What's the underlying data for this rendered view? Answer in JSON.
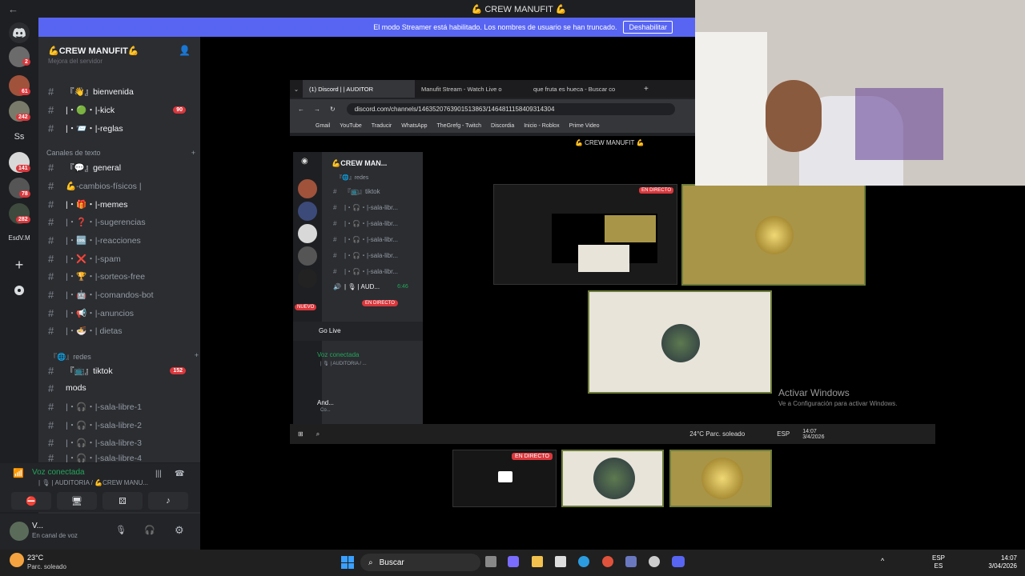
{
  "window": {
    "title": "💪 CREW MANUFIT 💪",
    "back_glyph": "←",
    "forward_glyph": "→"
  },
  "banner": {
    "message": "El modo Streamer está habilitado. Los nombres de usuario se han truncado.",
    "button": "Deshabilitar"
  },
  "rail": {
    "badges": [
      "2",
      "61",
      "242",
      "141",
      "78",
      "282"
    ],
    "initials": "Ss",
    "label": "EsdV.M"
  },
  "server": {
    "name": "💪CREW MANUFIT💪",
    "partial_top": "Mejora del servidor"
  },
  "channels_top": [
    {
      "label": "『👋』bienvenida",
      "count": ""
    },
    {
      "label": "|・🟢・|-kick",
      "count": "90"
    },
    {
      "label": "|・📨・|-reglas",
      "count": ""
    }
  ],
  "category_text": "Canales de texto",
  "channels_text": [
    {
      "label": "『💬』general",
      "white": true
    },
    {
      "label": "💪-cambios-físicos |",
      "white": false
    },
    {
      "label": "|・🎁・|-memes",
      "white": true
    },
    {
      "label": "|・❓・|-sugerencias",
      "white": false
    },
    {
      "label": "|・🆒・|-reacciones",
      "white": false
    },
    {
      "label": "|・❌・|-spam",
      "white": false
    },
    {
      "label": "|・🏆・|-sorteos-free",
      "white": false
    },
    {
      "label": "|・🤖・|-comandos-bot",
      "white": false
    },
    {
      "label": "|・📢・|-anuncios",
      "white": false
    },
    {
      "label": "|・🍜・| dietas",
      "white": false
    }
  ],
  "category_redes": "『🌐』redes",
  "channels_redes": [
    {
      "label": "『📺』tiktok",
      "count": "152",
      "white": true
    },
    {
      "label": "mods",
      "count": "",
      "white": true
    },
    {
      "label": "|・🎧・|-sala-libre-1",
      "count": "",
      "white": false
    },
    {
      "label": "|・🎧・|-sala-libre-2",
      "count": "",
      "white": false
    },
    {
      "label": "|・🎧・|-sala-libre-3",
      "count": "",
      "white": false
    },
    {
      "label": "|・🎧・|-sala-libre-4",
      "count": "",
      "white": false
    }
  ],
  "voice": {
    "status": "Voz conectada",
    "location": "| 🎙 | AUDITORIA / 💪CREW MANU..."
  },
  "user": {
    "name": "V...",
    "status": "En canal de voz"
  },
  "browser": {
    "tabs": [
      "(1) Discord | | AUDITOR",
      "Manufit Stream - Watch Live o",
      "que fruta es hueca - Buscar co"
    ],
    "url": "discord.com/channels/1463520763901513863/1464811158409314304",
    "bookmarks": [
      "Gmail",
      "YouTube",
      "Traducir",
      "WhatsApp",
      "TheGrefg - Twitch",
      "Discordia",
      "Inicio - Roblox",
      "Prime Video"
    ]
  },
  "inner": {
    "title": "💪 CREW MANUFIT 💪",
    "server": "💪CREW MAN...",
    "category": "『🌐』redes",
    "channels": [
      "『📺』tiktok",
      "|・🎧・|-sala-libr...",
      "|・🎧・|-sala-libr...",
      "|・🎧・|-sala-libr...",
      "|・🎧・|-sala-libr...",
      "|・🎧・|-sala-libr..."
    ],
    "audit": "| 🎙 | AUD...",
    "audit_time": "6:46",
    "live_tag": "EN DIRECTO",
    "new_tag": "NUEVO",
    "golive": "Go Live",
    "voice": "Voz conectada",
    "voice_loc": "| 🎙 | AUDITORIA / ...",
    "user": "And...",
    "user_sub": "Co...",
    "weather": "24°C  Parc. soleado",
    "lang": "ESP",
    "time": "14:07",
    "date": "3/4/2026"
  },
  "activate": {
    "title": "Activar Windows",
    "sub": "Ve a Configuración para activar Windows."
  },
  "live_badge": "EN DIRECTO",
  "taskbar": {
    "temp": "23°C",
    "weather": "Parc. soleado",
    "search": "Buscar",
    "lang1": "ESP",
    "lang2": "ES",
    "time": "14:07",
    "date": "3/04/2026"
  }
}
